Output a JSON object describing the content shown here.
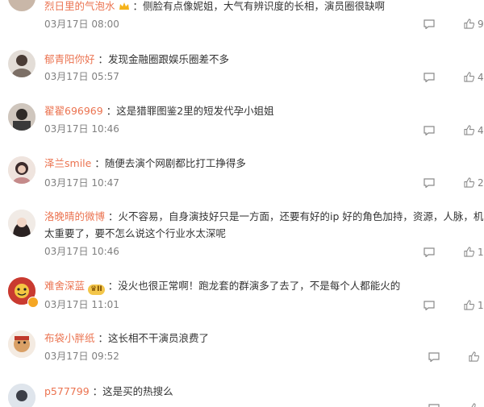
{
  "comments": [
    {
      "nick": "烈日里的气泡水",
      "text": "侧脸有点像妮姐，大气有辨识度的长相，演员圈很缺啊",
      "time": "03月17日 08:00",
      "likes": "9"
    },
    {
      "nick": "郁青阳你好",
      "text": "发现金融圈跟娱乐圈差不多",
      "time": "03月17日 05:57",
      "likes": "4"
    },
    {
      "nick": "翟翟696969",
      "text": "这是猎罪图鉴2里的短发代孕小姐姐",
      "time": "03月17日 10:46",
      "likes": "4"
    },
    {
      "nick": "泽兰smile",
      "text": "随便去演个网剧都比打工挣得多",
      "time": "03月17日 10:47",
      "likes": "2"
    },
    {
      "nick": "洛晚晴的微博",
      "text": "火不容易，自身演技好只是一方面，还要有好的ip 好的角色加持，资源，人脉，机会，",
      "text2": "太重要了，要不怎么说这个行业水太深呢",
      "time": "03月17日 10:46",
      "likes": "1"
    },
    {
      "nick": "难舍深蓝",
      "vip_label": "II",
      "text": "没火也很正常啊！跑龙套的群演多了去了，不是每个人都能火的",
      "time": "03月17日 11:01",
      "likes": "1"
    },
    {
      "nick": "布袋小胖纸",
      "text": "这长相不干演员浪费了",
      "time": "03月17日 09:52",
      "likes": ""
    },
    {
      "nick": "p577799",
      "text": "这是买的热搜么",
      "time": "",
      "likes": ""
    }
  ],
  "separator": "：",
  "colors": {
    "nick": "#eb7350",
    "time": "#808080",
    "text": "#333333"
  },
  "icons": {
    "reply": "comment-icon",
    "like": "thumbs-up-icon"
  }
}
